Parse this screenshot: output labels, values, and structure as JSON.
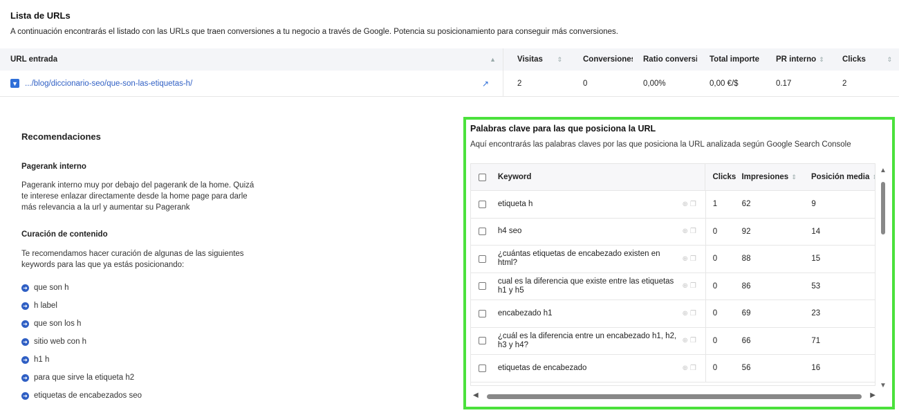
{
  "header": {
    "title": "Lista de URLs",
    "description": "A continuación encontrarás el listado con las URLs que traen conversiones a tu negocio a través de Google. Potencia su posicionamiento para conseguir más conversiones."
  },
  "url_table": {
    "columns": [
      "URL entrada",
      "Visitas",
      "Conversiones",
      "Ratio conversión",
      "Total importe",
      "PR interno",
      "Clicks"
    ],
    "row": {
      "url": ".../blog/diccionario-seo/que-son-las-etiquetas-h/",
      "visitas": "2",
      "conversiones": "0",
      "ratio": "0,00%",
      "total": "0,00 €/$",
      "pr": "0.17",
      "clicks": "2"
    }
  },
  "recommendations": {
    "title": "Recomendaciones",
    "pagerank_heading": "Pagerank interno",
    "pagerank_text": "Pagerank interno muy por debajo del pagerank de la home. Quizá te interese enlazar directamente desde la home page para darle más relevancia a la url y aumentar su Pagerank",
    "curation_heading": "Curación de contenido",
    "curation_text": "Te recomendamos hacer curación de algunas de las siguientes keywords para las que ya estás posicionando:",
    "keywords": [
      "que son h",
      "h label",
      "que son los h",
      "sitio web con h",
      "h1 h",
      "para que sirve la etiqueta h2",
      "etiquetas de encabezados seo"
    ]
  },
  "keywords_panel": {
    "title": "Palabras clave para las que posiciona la URL",
    "description": "Aquí encontrarás las palabras claves por las que posiciona la URL analizada según Google Search Console",
    "columns": {
      "keyword": "Keyword",
      "clicks": "Clicks",
      "impressions": "Impresiones",
      "position": "Posición media"
    },
    "rows": [
      {
        "keyword": "etiqueta h",
        "clicks": "1",
        "impressions": "62",
        "position": "9"
      },
      {
        "keyword": "h4 seo",
        "clicks": "0",
        "impressions": "92",
        "position": "14"
      },
      {
        "keyword": "¿cuántas etiquetas de encabezado existen en html?",
        "clicks": "0",
        "impressions": "88",
        "position": "15"
      },
      {
        "keyword": "cual es la diferencia que existe entre las etiquetas h1 y h5",
        "clicks": "0",
        "impressions": "86",
        "position": "53"
      },
      {
        "keyword": "encabezado h1",
        "clicks": "0",
        "impressions": "69",
        "position": "23"
      },
      {
        "keyword": "¿cuál es la diferencia entre un encabezado h1, h2, h3 y h4?",
        "clicks": "0",
        "impressions": "66",
        "position": "71"
      },
      {
        "keyword": "etiquetas de encabezado",
        "clicks": "0",
        "impressions": "56",
        "position": "16"
      }
    ]
  },
  "colors": {
    "accent": "#2f6fd8",
    "highlight_border": "#4be13c"
  }
}
